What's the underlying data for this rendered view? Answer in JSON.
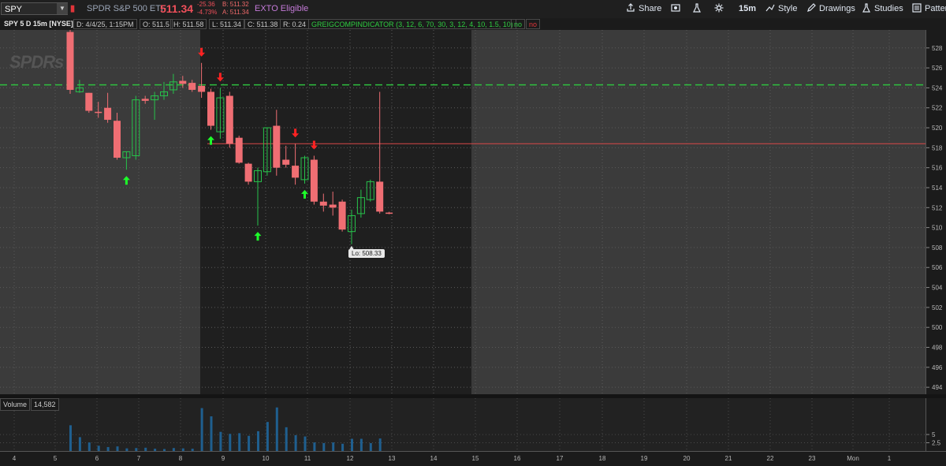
{
  "header": {
    "symbol": "SPY",
    "description": "SPDR S&P 500 ETF",
    "last_price": "511.34",
    "net_change": "-25.36",
    "pct_change": "-4.73%",
    "bid": "B: 511.32",
    "ask": "A: 511.34",
    "exto": "EXTO Eligible"
  },
  "toolbar": {
    "share": "Share",
    "timeframe": "15m",
    "style": "Style",
    "drawings": "Drawings",
    "studies": "Studies",
    "patterns": "Patter"
  },
  "infobar": {
    "title": "SPY 5 D 15m [NYSE]",
    "date": "D: 4/4/25, 1:15PM",
    "open": "O: 511.5",
    "high": "H: 511.58",
    "low": "L: 511.34",
    "close": "C: 511.38",
    "range": "R: 0.24",
    "study": "GREIGCOMPINDICATOR (3, 12, 6, 70, 30, 3, 12, 4, 10, 1.5, 10)",
    "study_no1": "no",
    "study_no2": "no"
  },
  "volume": {
    "label": "Volume",
    "value": "14,582"
  },
  "lo_label": "Lo: 508.33",
  "logo_text": "SPDRs",
  "colors": {
    "up": "#27c24b",
    "down": "#ef6e73",
    "signal_up": "#1dff2a",
    "signal_down": "#ff2222",
    "dashed_line": "#2fbf3f",
    "red_line": "#d94848",
    "volume_bar": "#1f5f8f"
  },
  "chart_data": {
    "type": "candlestick",
    "y_ticks": [
      "528",
      "526",
      "524",
      "522",
      "520",
      "518",
      "516",
      "514",
      "512",
      "510",
      "508",
      "506",
      "504",
      "502",
      "500",
      "498",
      "496",
      "494"
    ],
    "y_range": [
      493.3,
      529.8
    ],
    "volume_ticks": [
      "5",
      "2.5"
    ],
    "x_labels": [
      "4",
      "5",
      "6",
      "7",
      "8",
      "9",
      "10",
      "11",
      "12",
      "13",
      "14",
      "15",
      "16",
      "17",
      "18",
      "19",
      "20",
      "21",
      "22",
      "23",
      "Mon",
      "1"
    ],
    "horizontal_levels": [
      {
        "style": "dashed",
        "color": "green",
        "price": 524.3
      },
      {
        "style": "solid",
        "color": "red",
        "price": 518.4
      }
    ],
    "candles": [
      {
        "o": 529.6,
        "h": 529.8,
        "l": 523.4,
        "c": 523.8
      },
      {
        "o": 523.6,
        "h": 524.8,
        "l": 523.5,
        "c": 524.0
      },
      {
        "o": 523.5,
        "h": 523.5,
        "l": 521.5,
        "c": 521.7
      },
      {
        "o": 521.6,
        "h": 522.6,
        "l": 521.0,
        "c": 521.5
      },
      {
        "o": 522.0,
        "h": 523.5,
        "l": 520.5,
        "c": 520.8
      },
      {
        "o": 520.7,
        "h": 521.5,
        "l": 516.8,
        "c": 517.0
      },
      {
        "o": 517.0,
        "h": 517.6,
        "l": 515.8,
        "c": 517.6
      },
      {
        "o": 517.2,
        "h": 523.2,
        "l": 516.8,
        "c": 522.8
      },
      {
        "o": 522.9,
        "h": 523.2,
        "l": 522.4,
        "c": 522.7
      },
      {
        "o": 522.8,
        "h": 523.6,
        "l": 520.8,
        "c": 523.2
      },
      {
        "o": 523.2,
        "h": 524.6,
        "l": 522.8,
        "c": 523.6
      },
      {
        "o": 523.8,
        "h": 525.4,
        "l": 523.4,
        "c": 524.6
      },
      {
        "o": 524.7,
        "h": 525.2,
        "l": 524.0,
        "c": 524.4
      },
      {
        "o": 524.5,
        "h": 524.8,
        "l": 523.6,
        "c": 523.8
      },
      {
        "o": 524.2,
        "h": 526.5,
        "l": 523.0,
        "c": 523.6
      },
      {
        "o": 523.6,
        "h": 523.9,
        "l": 519.8,
        "c": 520.2
      },
      {
        "o": 519.6,
        "h": 524.0,
        "l": 518.9,
        "c": 523.0
      },
      {
        "o": 523.2,
        "h": 523.6,
        "l": 518.0,
        "c": 518.4
      },
      {
        "o": 519.0,
        "h": 519.2,
        "l": 516.4,
        "c": 516.5
      },
      {
        "o": 516.4,
        "h": 516.5,
        "l": 514.3,
        "c": 514.6
      },
      {
        "o": 514.6,
        "h": 516.0,
        "l": 510.2,
        "c": 515.7
      },
      {
        "o": 515.6,
        "h": 520.0,
        "l": 515.2,
        "c": 520.0
      },
      {
        "o": 520.2,
        "h": 521.8,
        "l": 515.2,
        "c": 516.0
      },
      {
        "o": 516.8,
        "h": 518.2,
        "l": 516.0,
        "c": 516.3
      },
      {
        "o": 516.2,
        "h": 518.4,
        "l": 514.3,
        "c": 515.0
      },
      {
        "o": 514.8,
        "h": 517.2,
        "l": 514.4,
        "c": 517.0
      },
      {
        "o": 516.8,
        "h": 517.2,
        "l": 512.3,
        "c": 512.6
      },
      {
        "o": 512.6,
        "h": 513.4,
        "l": 511.6,
        "c": 512.2
      },
      {
        "o": 512.3,
        "h": 513.6,
        "l": 511.2,
        "c": 512.0
      },
      {
        "o": 512.6,
        "h": 512.8,
        "l": 509.6,
        "c": 509.8
      },
      {
        "o": 509.6,
        "h": 511.8,
        "l": 508.33,
        "c": 511.2
      },
      {
        "o": 511.4,
        "h": 513.8,
        "l": 511.0,
        "c": 513.0
      },
      {
        "o": 512.8,
        "h": 514.8,
        "l": 512.6,
        "c": 514.6
      },
      {
        "o": 514.6,
        "h": 523.6,
        "l": 511.4,
        "c": 511.6
      },
      {
        "o": 511.5,
        "h": 511.58,
        "l": 511.34,
        "c": 511.38
      }
    ],
    "volume_values": [
      7.8,
      4.2,
      2.6,
      1.6,
      1.2,
      1.4,
      0.8,
      0.9,
      1.0,
      0.7,
      0.6,
      0.9,
      0.8,
      0.7,
      13.0,
      10.5,
      5.8,
      5.2,
      5.4,
      4.6,
      6.0,
      8.8,
      13.2,
      7.2,
      4.8,
      4.4,
      2.6,
      2.4,
      2.6,
      2.2,
      3.7,
      3.7,
      2.4,
      3.8
    ],
    "signals": [
      {
        "type": "up",
        "candle": 6
      },
      {
        "type": "down",
        "candle": 14
      },
      {
        "type": "down",
        "candle": 16
      },
      {
        "type": "up",
        "candle": 15
      },
      {
        "type": "up",
        "candle": 20
      },
      {
        "type": "down",
        "candle": 24
      },
      {
        "type": "down",
        "candle": 26
      },
      {
        "type": "up",
        "candle": 25
      }
    ]
  }
}
